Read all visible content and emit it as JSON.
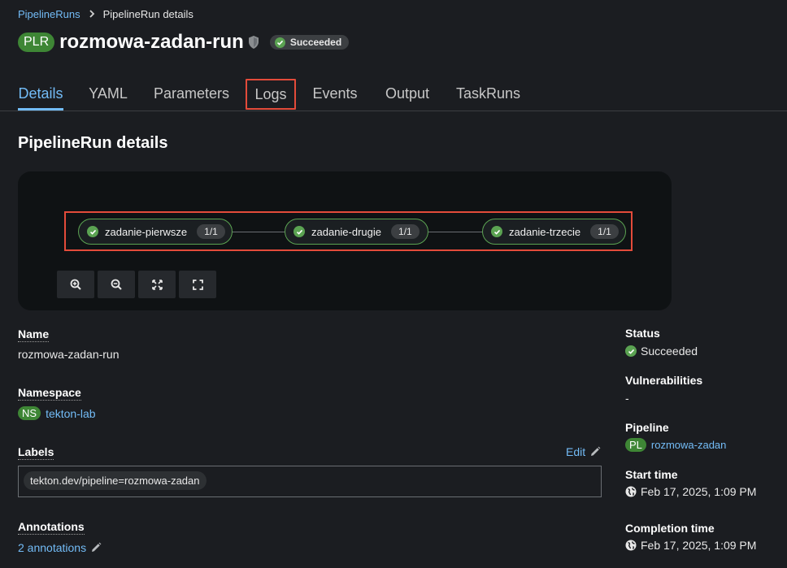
{
  "breadcrumb": {
    "parent": "PipelineRuns",
    "current": "PipelineRun details"
  },
  "header": {
    "badge": "PLR",
    "title": "rozmowa-zadan-run",
    "status": "Succeeded"
  },
  "tabs": [
    {
      "label": "Details",
      "active": true
    },
    {
      "label": "YAML"
    },
    {
      "label": "Parameters"
    },
    {
      "label": "Logs",
      "highlighted": true
    },
    {
      "label": "Events"
    },
    {
      "label": "Output"
    },
    {
      "label": "TaskRuns"
    }
  ],
  "section_title": "PipelineRun details",
  "topology": {
    "nodes": [
      {
        "label": "zadanie-pierwsze",
        "count": "1/1",
        "status": "succeeded"
      },
      {
        "label": "zadanie-drugie",
        "count": "1/1",
        "status": "succeeded"
      },
      {
        "label": "zadanie-trzecie",
        "count": "1/1",
        "status": "succeeded"
      }
    ],
    "controls": [
      "zoom-in-icon",
      "zoom-out-icon",
      "fit-to-screen-icon",
      "expand-icon"
    ]
  },
  "details": {
    "name_label": "Name",
    "name_value": "rozmowa-zadan-run",
    "namespace_label": "Namespace",
    "namespace_badge": "NS",
    "namespace_value": "tekton-lab",
    "labels_label": "Labels",
    "labels_edit": "Edit",
    "labels": [
      "tekton.dev/pipeline=rozmowa-zadan"
    ],
    "annotations_label": "Annotations",
    "annotations_value": "2 annotations"
  },
  "side": {
    "status_label": "Status",
    "status_value": "Succeeded",
    "vuln_label": "Vulnerabilities",
    "vuln_value": "-",
    "pipeline_label": "Pipeline",
    "pipeline_badge": "PL",
    "pipeline_value": "rozmowa-zadan",
    "start_label": "Start time",
    "start_value": "Feb 17, 2025, 1:09 PM",
    "completion_label": "Completion time",
    "completion_value": "Feb 17, 2025, 1:09 PM"
  },
  "colors": {
    "accent": "#73bcf7",
    "success": "#3e8635",
    "highlight": "#e34b3a",
    "background": "#1b1d21"
  }
}
